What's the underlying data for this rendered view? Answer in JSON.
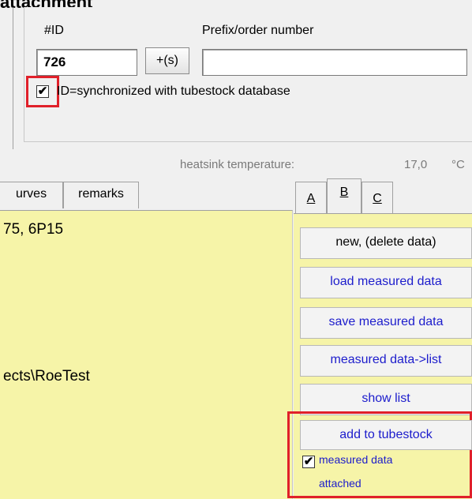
{
  "section_title": "attachment",
  "id_group": {
    "id_label": "#ID",
    "prefix_label": "Prefix/order number",
    "id_value": "726",
    "s_button": "+(s)",
    "prefix_value": "",
    "sync_checked": true,
    "sync_label": "ID=synchronized with tubestock database"
  },
  "status": {
    "heatsink_label": "heatsink temperature:",
    "heatsink_value": "17,0",
    "heatsink_unit": "°C"
  },
  "left_tabs": [
    "urves",
    "remarks"
  ],
  "memo_lines": [
    "75,  6P15",
    "ects\\RoeTest"
  ],
  "right_tabs": [
    "A",
    "B",
    "C"
  ],
  "actions": [
    {
      "label": "new, (delete data)"
    },
    {
      "label": "load measured data"
    },
    {
      "label": "save measured data"
    },
    {
      "label": "measured data->list"
    },
    {
      "label": "show list"
    },
    {
      "label": "add to tubestock"
    }
  ],
  "attached": {
    "checked": true,
    "line1": "measured data",
    "line2": "attached"
  },
  "colors": {
    "highlight": "#e0202a",
    "memo_bg": "#f6f4a8",
    "action_text": "#1c1ccc"
  }
}
